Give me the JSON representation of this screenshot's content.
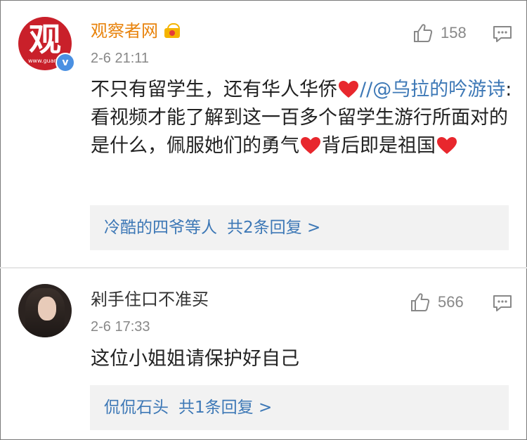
{
  "colors": {
    "username_vip": "#e8830c",
    "link": "#3d78b6",
    "meta": "#888888",
    "heart": "#e8272d",
    "reply_bg": "#f2f2f2"
  },
  "comments": [
    {
      "username": "观察者网",
      "avatar_glyph": "观",
      "avatar_small": "www.guancha.cn",
      "badge_icon": "crown-vip-icon",
      "time": "2-6 21:11",
      "likes": "158",
      "text_parts": [
        "不只有留学生，还有华人华侨",
        "//",
        "@乌拉的吟游诗",
        ": 看视频才能了解到这一百多个留学生游行所面对的是什么，佩服她们的勇气",
        "背后即是祖国"
      ],
      "reply_users": "冷酷的四爷等人",
      "reply_count": "共2条回复 >"
    },
    {
      "username": "剁手住口不准买",
      "time": "2-6 17:33",
      "likes": "566",
      "text": "这位小姐姐请保护好自己",
      "reply_users": "侃侃石头",
      "reply_count": "共1条回复 >"
    }
  ]
}
